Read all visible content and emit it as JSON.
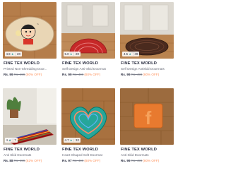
{
  "products": [
    {
      "rating": "4.9",
      "count": "20",
      "brand": "FINE TEX WORLD",
      "title": "Printed Non-Shredding Door...",
      "price": "Rs. 99",
      "mrp": "Rs. 499",
      "discount": "(80% OFF)",
      "image": "cartoon-oval-doormat"
    },
    {
      "rating": "5.0",
      "count": "20",
      "brand": "FINE TEX WORLD",
      "title": "Self Design Anti-Skid Doormat",
      "price": "Rs. 99",
      "mrp": "Rs. 499",
      "discount": "(80% OFF)",
      "image": "red-halfmoon-doormat"
    },
    {
      "rating": "4.5",
      "count": "49",
      "brand": "FINE TEX WORLD",
      "title": "Self Design Antiskid Doormats",
      "price": "Rs. 99",
      "mrp": "Rs. 499",
      "discount": "(80% OFF)",
      "image": "brown-oval-doormat"
    },
    {
      "rating": "4",
      "count": "7",
      "brand": "FINE TEX WORLD",
      "title": "Anti Skid Doormats",
      "price": "Rs. 88",
      "mrp": "Rs. 499",
      "discount": "(82% OFF)",
      "image": "striped-runner-doormat"
    },
    {
      "rating": "4.7",
      "count": "32",
      "brand": "FINE TEX WORLD",
      "title": "Heart-Shaped Soft Doormat",
      "price": "Rs. 97",
      "mrp": "Rs. 499",
      "discount": "(80% OFF)",
      "image": "heart-doormat"
    },
    {
      "rating": "",
      "count": "",
      "brand": "FINE TEX WORLD",
      "title": "Anti-Skid Doormats",
      "price": "Rs. 99",
      "mrp": "Rs. 499",
      "discount": "(80% OFF)",
      "image": "facebook-logo-doormat"
    }
  ],
  "colors": {
    "accent_discount": "#ff905a",
    "rating_star": "#14958f",
    "text": "#282c3f"
  }
}
